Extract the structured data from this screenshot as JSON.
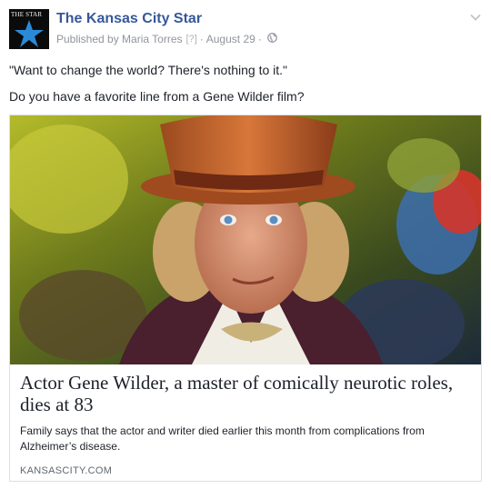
{
  "post": {
    "page_name": "The Kansas City Star",
    "avatar_wordmark": "THE STAR",
    "published_by": "Published by Maria Torres",
    "help_marker": "[?]",
    "date": "August 29",
    "separator": "·",
    "privacy_icon": "globe-icon",
    "menu_icon": "chevron-down-icon"
  },
  "message": {
    "line1": "\"Want to change the world? There's nothing to it.\"",
    "line2": "Do you have a favorite line from a Gene Wilder film?"
  },
  "link_card": {
    "title": "Actor Gene Wilder, a master of comically neurotic roles, dies at 83",
    "description": "Family says that the actor and writer died earlier this month from complications from Alzheimer’s disease.",
    "domain": "KANSASCITY.COM"
  },
  "colors": {
    "link_blue": "#365899",
    "meta_gray": "#90949c",
    "text": "#1d2129",
    "border": "#dddfe2"
  }
}
